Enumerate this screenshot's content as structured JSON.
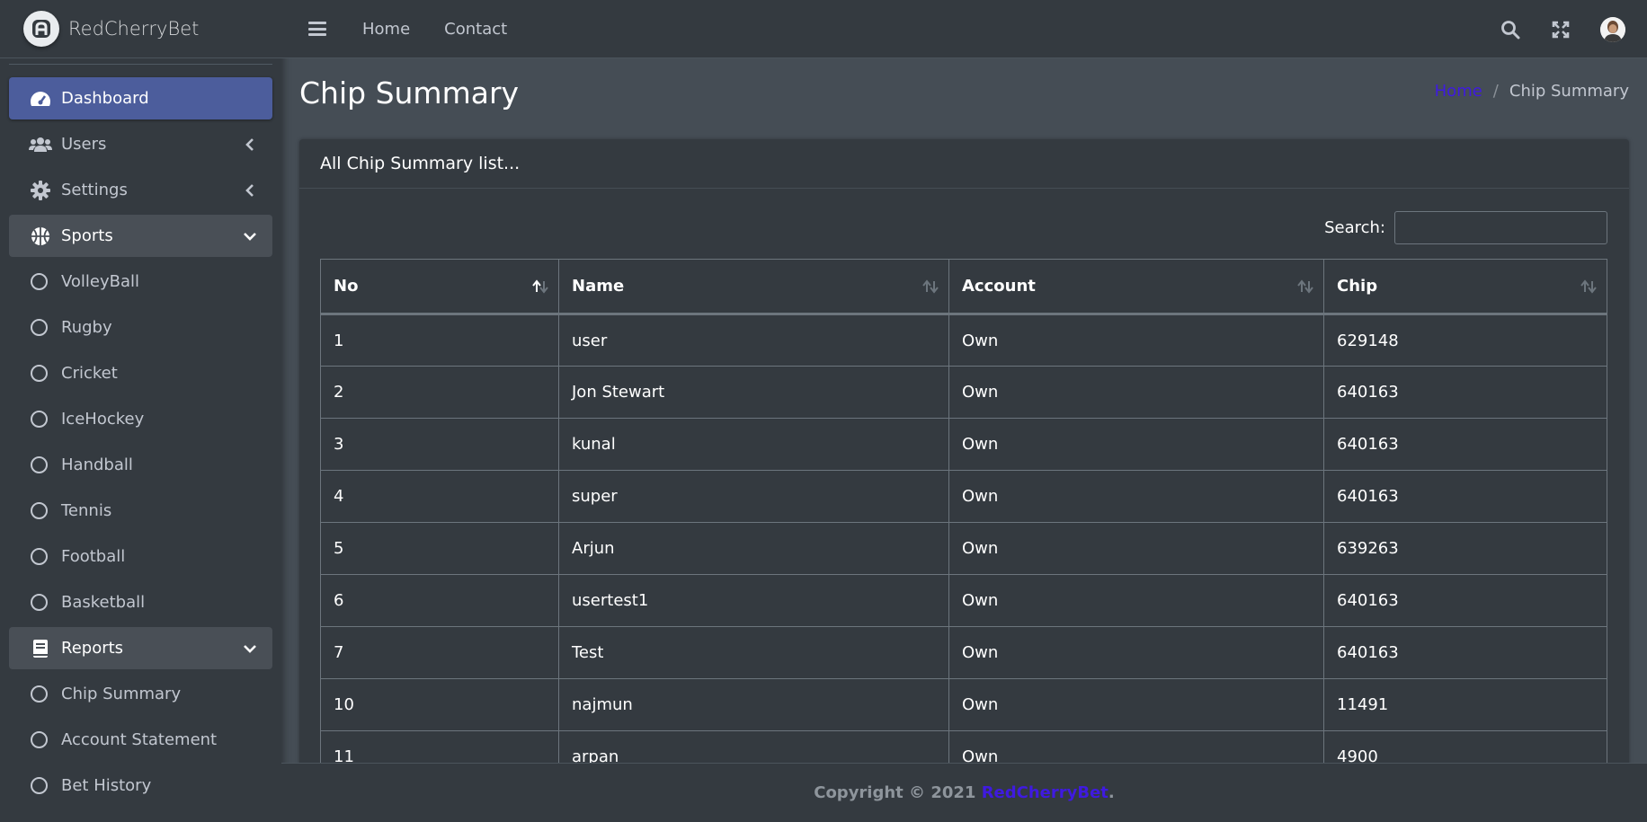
{
  "brand": {
    "name": "RedCherryBet",
    "logo_icon": "brand-logo-icon"
  },
  "sidebar": {
    "items": [
      {
        "label": "Dashboard",
        "icon": "dashboard-icon",
        "state": "active"
      },
      {
        "label": "Users",
        "icon": "users-icon",
        "arrow": "chevron-left-icon"
      },
      {
        "label": "Settings",
        "icon": "gear-icon",
        "arrow": "chevron-left-icon"
      },
      {
        "label": "Sports",
        "icon": "basketball-icon",
        "arrow": "chevron-down-icon",
        "state": "open"
      }
    ],
    "sports": [
      "VolleyBall",
      "Rugby",
      "Cricket",
      "IceHockey",
      "Handball",
      "Tennis",
      "Football",
      "Basketball"
    ],
    "reports": {
      "label": "Reports",
      "icon": "book-icon",
      "arrow": "chevron-down-icon"
    },
    "report_items": [
      "Chip Summary",
      "Account Statement",
      "Bet History"
    ]
  },
  "topbar": {
    "links": [
      "Home",
      "Contact"
    ],
    "icons": [
      "search-icon",
      "fullscreen-icon",
      "avatar"
    ]
  },
  "page": {
    "title": "Chip Summary",
    "breadcrumb": {
      "home": "Home",
      "separator": "/",
      "current": "Chip Summary"
    }
  },
  "card": {
    "header": "All Chip Summary list...",
    "search_label": "Search:",
    "search_value": ""
  },
  "table": {
    "columns": [
      "No",
      "Name",
      "Account",
      "Chip"
    ],
    "rows": [
      [
        "1",
        "user",
        "Own",
        "629148"
      ],
      [
        "2",
        "Jon Stewart",
        "Own",
        "640163"
      ],
      [
        "3",
        "kunal",
        "Own",
        "640163"
      ],
      [
        "4",
        "super",
        "Own",
        "640163"
      ],
      [
        "5",
        "Arjun",
        "Own",
        "639263"
      ],
      [
        "6",
        "usertest1",
        "Own",
        "640163"
      ],
      [
        "7",
        "Test",
        "Own",
        "640163"
      ],
      [
        "10",
        "najmun",
        "Own",
        "11491"
      ],
      [
        "11",
        "arpan",
        "Own",
        "4900"
      ]
    ]
  },
  "footer": {
    "prefix": "Copyright © 2021 ",
    "brand": "RedCherryBet",
    "suffix": "."
  },
  "colors": {
    "accent": "#4c5d9c",
    "link": "#3f1ae0",
    "sidebar_bg": "#343a40",
    "body_bg": "#454d55"
  }
}
